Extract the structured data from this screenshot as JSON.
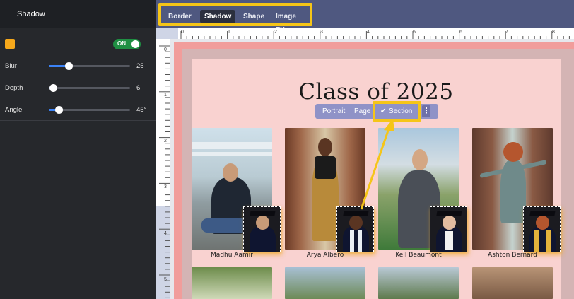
{
  "panel": {
    "title": "Shadow",
    "color_swatch": "#f6a81b",
    "toggle": {
      "label": "ON",
      "state": "on"
    },
    "sliders": [
      {
        "label": "Blur",
        "value": "25",
        "fraction": 0.25
      },
      {
        "label": "Depth",
        "value": "6",
        "fraction": 0.06
      },
      {
        "label": "Angle",
        "value": "45°",
        "fraction": 0.125
      }
    ]
  },
  "tabs": [
    {
      "label": "Border",
      "active": false
    },
    {
      "label": "Shadow",
      "active": true
    },
    {
      "label": "Shape",
      "active": false
    },
    {
      "label": "Image FX",
      "active": false
    }
  ],
  "rulers": {
    "horizontal": [
      "0",
      "1",
      "2",
      "3",
      "4",
      "5",
      "6",
      "7",
      "8"
    ],
    "vertical": [
      "0",
      "1",
      "2",
      "3",
      "4",
      "5"
    ]
  },
  "page": {
    "heading": "Class of 2025",
    "students": [
      {
        "name": "Madhu Aamir"
      },
      {
        "name": "Arya Albero"
      },
      {
        "name": "Kell Beaumont"
      },
      {
        "name": "Ashton Bernard"
      }
    ]
  },
  "context_toolbar": {
    "items": [
      "Portrait",
      "Page",
      "Section"
    ],
    "selected": "Section",
    "more_icon": "vertical-dots-icon"
  },
  "colors": {
    "accent_highlight": "#f5c518",
    "toolbar": "#4f5880",
    "page": "#f9d2d0",
    "bleed": "#f19d9b"
  }
}
